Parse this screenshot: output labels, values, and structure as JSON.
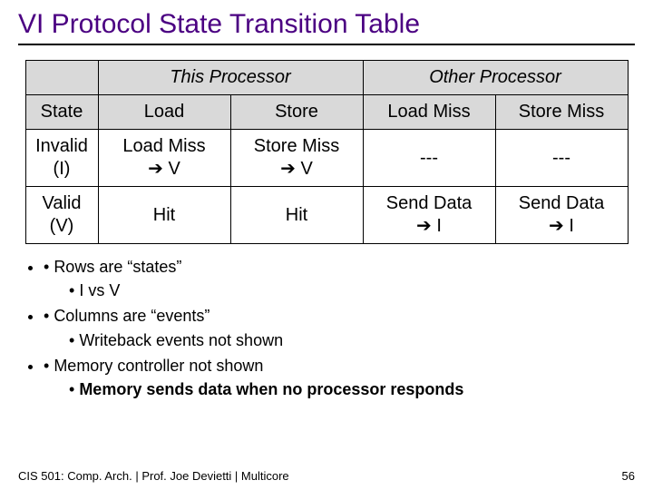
{
  "title": "VI Protocol State Transition Table",
  "table": {
    "top": {
      "corner": "",
      "this": "This Processor",
      "other": "Other Processor"
    },
    "evhdr": {
      "state": "State",
      "load": "Load",
      "store": "Store",
      "loadmiss": "Load Miss",
      "storemiss": "Store Miss"
    },
    "rowI": {
      "state": "Invalid (I)",
      "load": "Load Miss ➔ V",
      "store": "Store Miss ➔ V",
      "loadmiss": "---",
      "storemiss": "---"
    },
    "rowV": {
      "state": "Valid (V)",
      "load": "Hit",
      "store": "Hit",
      "loadmiss": "Send Data ➔ I",
      "storemiss": "Send Data ➔ I"
    }
  },
  "bullets": {
    "b1": "Rows are “states”",
    "b1a": "I vs V",
    "b2": "Columns are “events”",
    "b2a": "Writeback events not shown",
    "b3": "Memory controller not shown",
    "b3a": "Memory sends data when no processor responds"
  },
  "footer": {
    "left": "CIS 501: Comp. Arch.  |  Prof. Joe Devietti  |  Multicore",
    "right": "56"
  }
}
